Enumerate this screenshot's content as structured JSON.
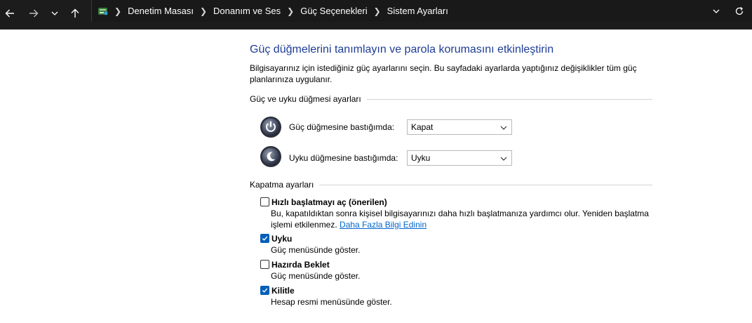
{
  "nav": {
    "back_icon": "arrow-left-icon",
    "forward_icon": "arrow-right-icon",
    "recent_icon": "chevron-down-icon",
    "up_icon": "arrow-up-icon",
    "refresh_icon": "refresh-icon"
  },
  "breadcrumb": [
    "Denetim Masası",
    "Donanım ve Ses",
    "Güç Seçenekleri",
    "Sistem Ayarları"
  ],
  "page": {
    "title": "Güç düğmelerini tanımlayın ve parola korumasını etkinleştirin",
    "description": "Bilgisayarınız için istediğiniz güç ayarlarını seçin. Bu sayfadaki ayarlarda yaptığınız değişiklikler tüm güç planlarınıza uygulanır."
  },
  "power_section": {
    "title": "Güç ve uyku düğmesi ayarları",
    "rows": [
      {
        "label": "Güç düğmesine bastığımda:",
        "value": "Kapat",
        "icon": "power-button-icon"
      },
      {
        "label": "Uyku düğmesine bastığımda:",
        "value": "Uyku",
        "icon": "sleep-button-icon"
      }
    ]
  },
  "shutdown_section": {
    "title": "Kapatma ayarları",
    "options": [
      {
        "label": "Hızlı başlatmayı aç (önerilen)",
        "checked": false,
        "description": "Bu, kapatıldıktan sonra kişisel bilgisayarınızı daha hızlı başlatmanıza yardımcı olur. Yeniden başlatma işlemi etkilenmez.",
        "link": "Daha Fazla Bilgi Edinin"
      },
      {
        "label": "Uyku",
        "checked": true,
        "description": "Güç menüsünde göster."
      },
      {
        "label": "Hazırda Beklet",
        "checked": false,
        "description": "Güç menüsünde göster."
      },
      {
        "label": "Kilitle",
        "checked": true,
        "description": "Hesap resmi menüsünde göster."
      }
    ]
  },
  "colors": {
    "title": "#1e3c96",
    "link": "#0066cc",
    "checkbox_checked": "#005fb8",
    "titlebar": "#1c1c1c"
  }
}
